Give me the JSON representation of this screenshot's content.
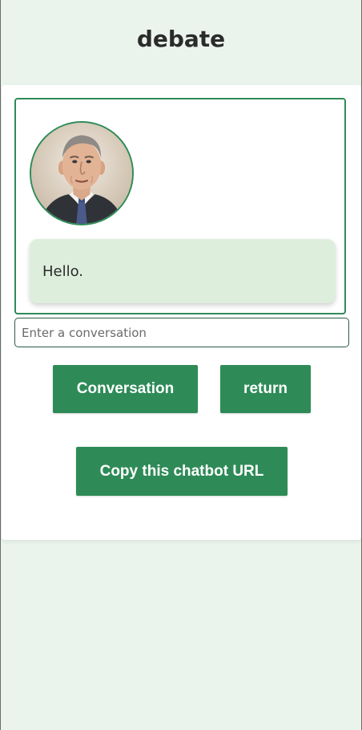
{
  "header": {
    "title": "debate"
  },
  "chat": {
    "avatar_icon": "person-portrait-icon",
    "messages": [
      {
        "text": "Hello."
      }
    ]
  },
  "input": {
    "placeholder": "Enter a conversation",
    "value": ""
  },
  "buttons": {
    "conversation": "Conversation",
    "return": "return",
    "copy_url": "Copy this chatbot URL"
  },
  "colors": {
    "accent": "#2e8b57",
    "page_background": "#eaf4ec",
    "bubble_background": "#deeedd"
  }
}
